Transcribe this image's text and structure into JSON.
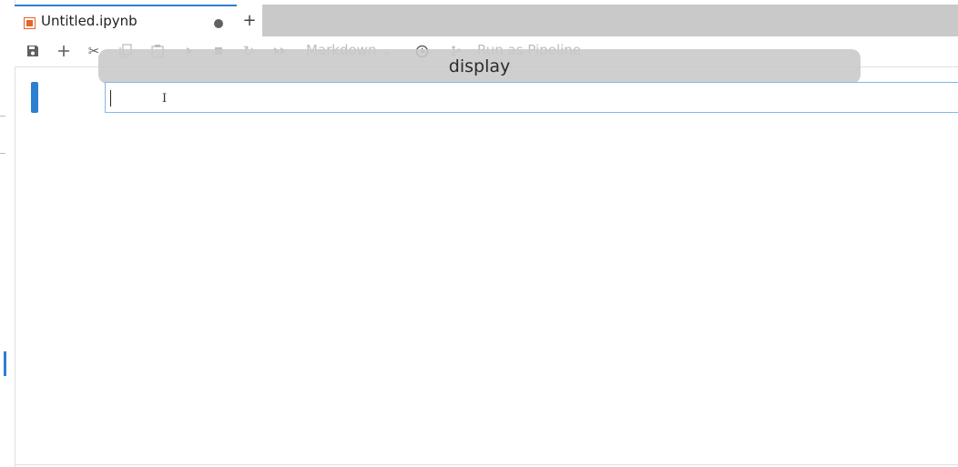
{
  "tab": {
    "title": "Untitled.ipynb",
    "icon": "notebook-file-icon",
    "unsaved": true,
    "new_tab_label": "+"
  },
  "toolbar": {
    "cell_type": "Markdown ⌄",
    "run_pipeline_label": "Run as Pipeline"
  },
  "tooltip": {
    "text": "display"
  },
  "colors": {
    "accent": "#2d7fd3",
    "file_icon": "#e3662b"
  }
}
